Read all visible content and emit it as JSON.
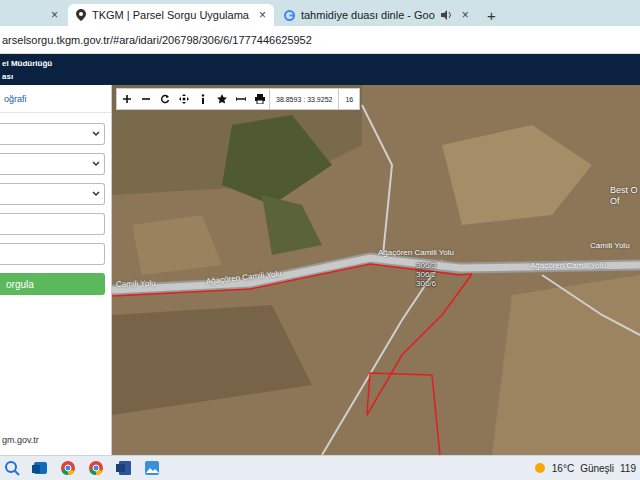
{
  "browser": {
    "tabs": [
      {
        "label": null,
        "close": "×",
        "selected": false,
        "audio": false
      },
      {
        "label": "TKGM | Parsel Sorgu Uygulama",
        "close": "×",
        "selected": true,
        "audio": false
      },
      {
        "label": "tahmidiye duası dinle - Goo",
        "close": "×",
        "selected": false,
        "audio": true
      }
    ],
    "new_tab": "+",
    "url": "arselsorgu.tkgm.gov.tr/#ara/idari/206798/306/6/1777446625952"
  },
  "app": {
    "header": [
      "el Müdürlüğü",
      "ası"
    ],
    "sidebar": {
      "tab": "oğrafi",
      "fields": [
        {
          "kind": "select"
        },
        {
          "kind": "select"
        },
        {
          "kind": "select"
        },
        {
          "kind": "input"
        },
        {
          "kind": "input"
        }
      ],
      "button": "orgula",
      "footer": "gm.gov.tr"
    },
    "map": {
      "coords": "38.8593 : 33.9252",
      "zoom": "16",
      "road_labels": [
        "Camili Yolu",
        "Ağaçören Camili Yolu",
        "Ağaçören Camili Yolu",
        "Camili Yolu",
        "Ağaçören Camili Yolu"
      ],
      "parcel_labels": [
        "306/3",
        "306/2",
        "306/6"
      ],
      "place_label": [
        "Best O",
        "Of"
      ]
    }
  },
  "taskbar": {
    "weather": "16°C",
    "condition": "Güneşli",
    "clock": "119"
  }
}
